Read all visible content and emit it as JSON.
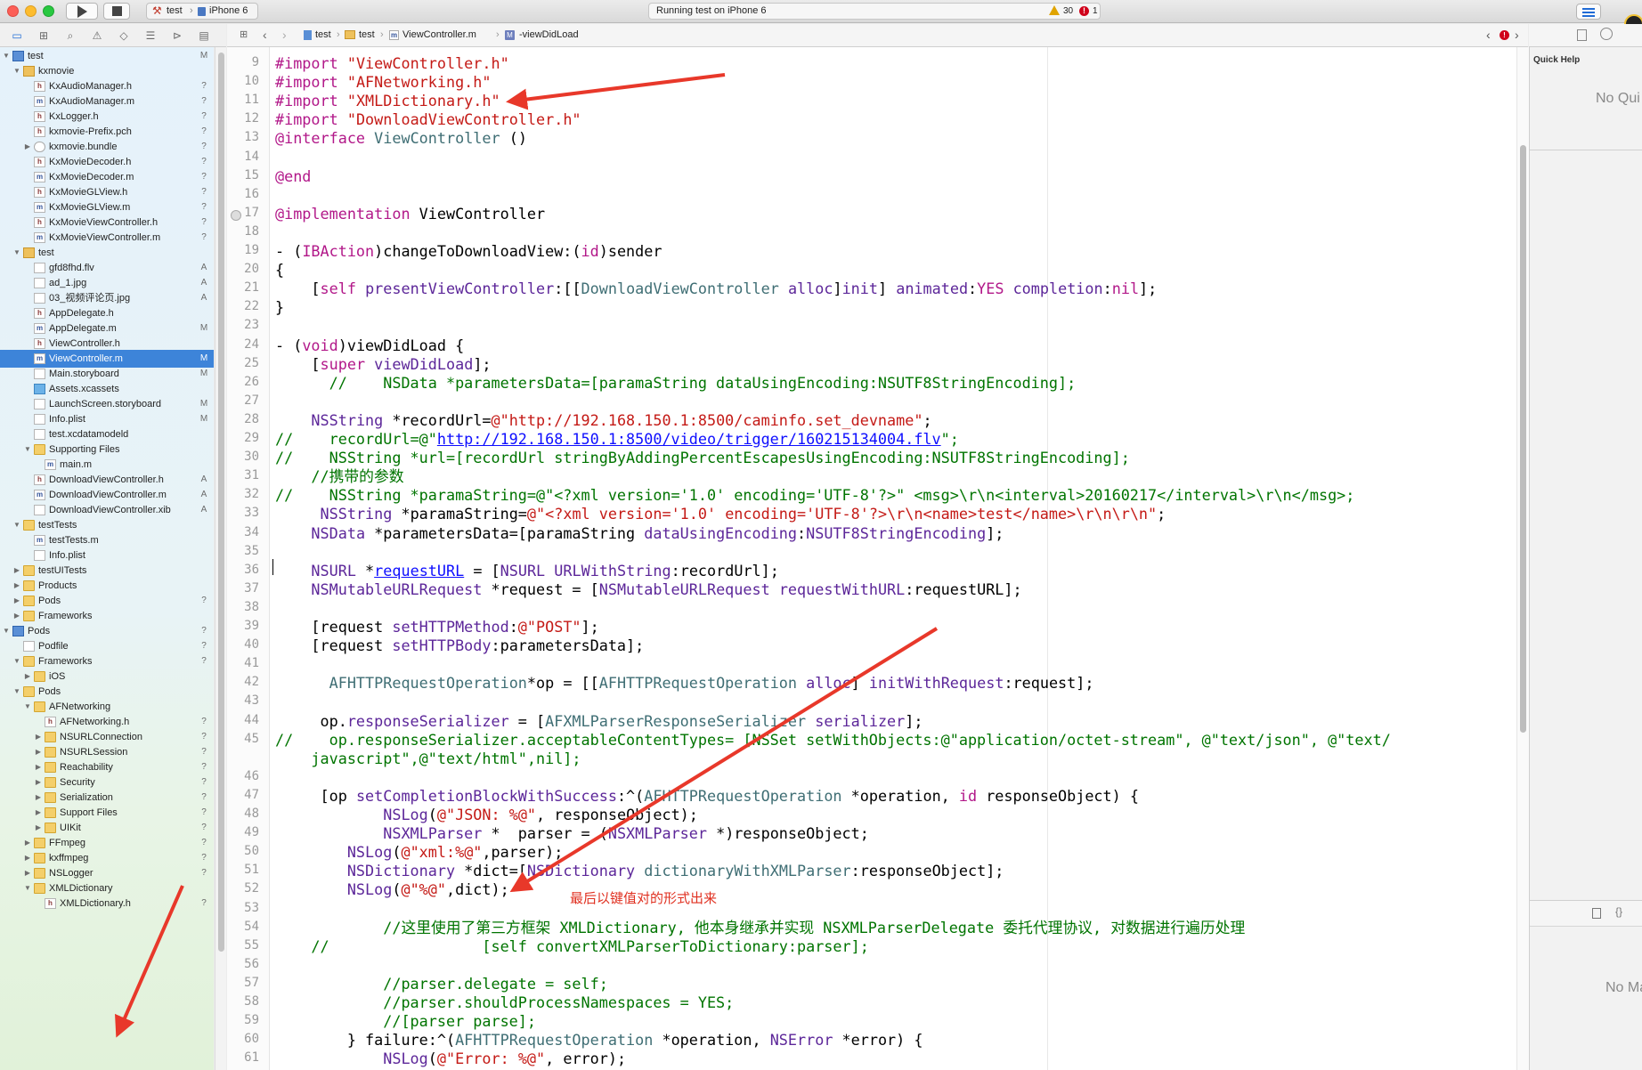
{
  "toolbar": {
    "scheme": "test",
    "device": "iPhone 6",
    "status": "Running test on iPhone 6",
    "warnings": "30",
    "errors": "1"
  },
  "jumpbar": {
    "crumbs": [
      "test",
      "test",
      "ViewController.m",
      "-viewDidLoad"
    ]
  },
  "navigator": {
    "rows": [
      {
        "d": 0,
        "disc": "open",
        "icon": "proj",
        "name": "test",
        "st": "M"
      },
      {
        "d": 1,
        "disc": "open",
        "icon": "group",
        "name": "kxmovie",
        "st": ""
      },
      {
        "d": 2,
        "disc": "",
        "icon": "h",
        "name": "KxAudioManager.h",
        "st": "?"
      },
      {
        "d": 2,
        "disc": "",
        "icon": "m",
        "name": "KxAudioManager.m",
        "st": "?"
      },
      {
        "d": 2,
        "disc": "",
        "icon": "h",
        "name": "KxLogger.h",
        "st": "?"
      },
      {
        "d": 2,
        "disc": "",
        "icon": "h",
        "name": "kxmovie-Prefix.pch",
        "st": "?"
      },
      {
        "d": 2,
        "disc": "closed",
        "icon": "bundle",
        "name": "kxmovie.bundle",
        "st": "?"
      },
      {
        "d": 2,
        "disc": "",
        "icon": "h",
        "name": "KxMovieDecoder.h",
        "st": "?"
      },
      {
        "d": 2,
        "disc": "",
        "icon": "m",
        "name": "KxMovieDecoder.m",
        "st": "?"
      },
      {
        "d": 2,
        "disc": "",
        "icon": "h",
        "name": "KxMovieGLView.h",
        "st": "?"
      },
      {
        "d": 2,
        "disc": "",
        "icon": "m",
        "name": "KxMovieGLView.m",
        "st": "?"
      },
      {
        "d": 2,
        "disc": "",
        "icon": "h",
        "name": "KxMovieViewController.h",
        "st": "?"
      },
      {
        "d": 2,
        "disc": "",
        "icon": "m",
        "name": "KxMovieViewController.m",
        "st": "?"
      },
      {
        "d": 1,
        "disc": "open",
        "icon": "group",
        "name": "test",
        "st": ""
      },
      {
        "d": 2,
        "disc": "",
        "icon": "other",
        "name": "gfd8fhd.flv",
        "st": "A"
      },
      {
        "d": 2,
        "disc": "",
        "icon": "other",
        "name": "ad_1.jpg",
        "st": "A"
      },
      {
        "d": 2,
        "disc": "",
        "icon": "other",
        "name": "03_视频评论页.jpg",
        "st": "A"
      },
      {
        "d": 2,
        "disc": "",
        "icon": "h",
        "name": "AppDelegate.h",
        "st": ""
      },
      {
        "d": 2,
        "disc": "",
        "icon": "m",
        "name": "AppDelegate.m",
        "st": "M"
      },
      {
        "d": 2,
        "disc": "",
        "icon": "h",
        "name": "ViewController.h",
        "st": ""
      },
      {
        "d": 2,
        "disc": "",
        "icon": "m",
        "name": "ViewController.m",
        "st": "M",
        "sel": true
      },
      {
        "d": 2,
        "disc": "",
        "icon": "other",
        "name": "Main.storyboard",
        "st": "M"
      },
      {
        "d": 2,
        "disc": "",
        "icon": "assets",
        "name": "Assets.xcassets",
        "st": ""
      },
      {
        "d": 2,
        "disc": "",
        "icon": "other",
        "name": "LaunchScreen.storyboard",
        "st": "M"
      },
      {
        "d": 2,
        "disc": "",
        "icon": "other",
        "name": "Info.plist",
        "st": "M"
      },
      {
        "d": 2,
        "disc": "",
        "icon": "other",
        "name": "test.xcdatamodeld",
        "st": ""
      },
      {
        "d": 2,
        "disc": "open",
        "icon": "folder",
        "name": "Supporting Files",
        "st": ""
      },
      {
        "d": 3,
        "disc": "",
        "icon": "m",
        "name": "main.m",
        "st": ""
      },
      {
        "d": 2,
        "disc": "",
        "icon": "h",
        "name": "DownloadViewController.h",
        "st": "A"
      },
      {
        "d": 2,
        "disc": "",
        "icon": "m",
        "name": "DownloadViewController.m",
        "st": "A"
      },
      {
        "d": 2,
        "disc": "",
        "icon": "other",
        "name": "DownloadViewController.xib",
        "st": "A"
      },
      {
        "d": 1,
        "disc": "open",
        "icon": "folder",
        "name": "testTests",
        "st": ""
      },
      {
        "d": 2,
        "disc": "",
        "icon": "m",
        "name": "testTests.m",
        "st": ""
      },
      {
        "d": 2,
        "disc": "",
        "icon": "other",
        "name": "Info.plist",
        "st": ""
      },
      {
        "d": 1,
        "disc": "closed",
        "icon": "folder",
        "name": "testUITests",
        "st": ""
      },
      {
        "d": 1,
        "disc": "closed",
        "icon": "folder",
        "name": "Products",
        "st": ""
      },
      {
        "d": 1,
        "disc": "closed",
        "icon": "folder",
        "name": "Pods",
        "st": "?"
      },
      {
        "d": 1,
        "disc": "closed",
        "icon": "folder",
        "name": "Frameworks",
        "st": ""
      },
      {
        "d": 0,
        "disc": "open",
        "icon": "proj",
        "name": "Pods",
        "st": "?"
      },
      {
        "d": 1,
        "disc": "",
        "icon": "other",
        "name": "Podfile",
        "st": "?"
      },
      {
        "d": 1,
        "disc": "open",
        "icon": "folder",
        "name": "Frameworks",
        "st": "?"
      },
      {
        "d": 2,
        "disc": "closed",
        "icon": "folder",
        "name": "iOS",
        "st": ""
      },
      {
        "d": 1,
        "disc": "open",
        "icon": "folder",
        "name": "Pods",
        "st": ""
      },
      {
        "d": 2,
        "disc": "open",
        "icon": "folder",
        "name": "AFNetworking",
        "st": ""
      },
      {
        "d": 3,
        "disc": "",
        "icon": "h",
        "name": "AFNetworking.h",
        "st": "?"
      },
      {
        "d": 3,
        "disc": "closed",
        "icon": "folder",
        "name": "NSURLConnection",
        "st": "?"
      },
      {
        "d": 3,
        "disc": "closed",
        "icon": "folder",
        "name": "NSURLSession",
        "st": "?"
      },
      {
        "d": 3,
        "disc": "closed",
        "icon": "folder",
        "name": "Reachability",
        "st": "?"
      },
      {
        "d": 3,
        "disc": "closed",
        "icon": "folder",
        "name": "Security",
        "st": "?"
      },
      {
        "d": 3,
        "disc": "closed",
        "icon": "folder",
        "name": "Serialization",
        "st": "?"
      },
      {
        "d": 3,
        "disc": "closed",
        "icon": "folder",
        "name": "Support Files",
        "st": "?"
      },
      {
        "d": 3,
        "disc": "closed",
        "icon": "folder",
        "name": "UIKit",
        "st": "?"
      },
      {
        "d": 2,
        "disc": "closed",
        "icon": "folder",
        "name": "FFmpeg",
        "st": "?"
      },
      {
        "d": 2,
        "disc": "closed",
        "icon": "folder",
        "name": "kxffmpeg",
        "st": "?"
      },
      {
        "d": 2,
        "disc": "closed",
        "icon": "folder",
        "name": "NSLogger",
        "st": "?"
      },
      {
        "d": 2,
        "disc": "open",
        "icon": "folder",
        "name": "XMLDictionary",
        "st": ""
      },
      {
        "d": 3,
        "disc": "",
        "icon": "h",
        "name": "XMLDictionary.h",
        "st": "?"
      }
    ]
  },
  "editor": {
    "lines": [
      {
        "n": "9",
        "html": "<span class=\"k\">#import</span> <span class=\"s\">\"ViewController.h\"</span>"
      },
      {
        "n": "10",
        "html": "<span class=\"k\">#import</span> <span class=\"s\">\"AFNetworking.h\"</span>"
      },
      {
        "n": "11",
        "html": "<span class=\"k\">#import</span> <span class=\"s\">\"XMLDictionary.h\"</span>"
      },
      {
        "n": "12",
        "html": "<span class=\"k\">#import</span> <span class=\"s\">\"DownloadViewController.h\"</span>"
      },
      {
        "n": "13",
        "html": "<span class=\"k\">@interface</span> <span class=\"cls\">ViewController</span> ()"
      },
      {
        "n": "14",
        "html": ""
      },
      {
        "n": "15",
        "html": "<span class=\"k\">@end</span>"
      },
      {
        "n": "16",
        "html": ""
      },
      {
        "n": "17",
        "html": "<span class=\"k\">@implementation</span> ViewController"
      },
      {
        "n": "18",
        "html": ""
      },
      {
        "n": "19",
        "html": "- (<span class=\"k\">IBAction</span>)changeToDownloadView:(<span class=\"k\">id</span>)sender"
      },
      {
        "n": "20",
        "html": "{"
      },
      {
        "n": "21",
        "html": "    [<span class=\"k\">self</span> <span class=\"t\">presentViewController</span>:[[<span class=\"cls\">DownloadViewController</span> <span class=\"t\">alloc</span>]<span class=\"t\">init</span>] <span class=\"t\">animated</span>:<span class=\"k\">YES</span> <span class=\"t\">completion</span>:<span class=\"k\">nil</span>];"
      },
      {
        "n": "22",
        "html": "}"
      },
      {
        "n": "23",
        "html": ""
      },
      {
        "n": "24",
        "html": "- (<span class=\"k\">void</span>)viewDidLoad {"
      },
      {
        "n": "25",
        "html": "    [<span class=\"k\">super</span> <span class=\"t\">viewDidLoad</span>];"
      },
      {
        "n": "26",
        "html": "<span class=\"c\">      //    NSData *parametersData=[paramaString dataUsingEncoding:NSUTF8StringEncoding];</span>"
      },
      {
        "n": "27",
        "html": ""
      },
      {
        "n": "28",
        "html": "    <span class=\"t\">NSString</span> *recordUrl=<span class=\"s\">@\"http://192.168.150.1:8500/caminfo.set_devname\"</span>;"
      },
      {
        "n": "29",
        "html": "<span class=\"c\">//    recordUrl=@\"</span><span class=\"u\">http://192.168.150.1:8500/video/trigger/160215134004.flv</span><span class=\"c\">\";</span>"
      },
      {
        "n": "30",
        "html": "<span class=\"c\">//    NSString *url=[recordUrl stringByAddingPercentEscapesUsingEncoding:NSUTF8StringEncoding];</span>"
      },
      {
        "n": "31",
        "html": "<span class=\"c\">    //携带的参数</span>"
      },
      {
        "n": "32",
        "html": "<span class=\"c\">//    NSString *paramaString=@\"&lt;?xml version='1.0' encoding='UTF-8'?&gt;\" &lt;msg&gt;\\r\\n&lt;interval&gt;20160217&lt;/interval&gt;\\r\\n&lt;/msg&gt;;</span>"
      },
      {
        "n": "33",
        "html": "     <span class=\"t\">NSString</span> *paramaString=<span class=\"s\">@\"&lt;?xml version='1.0' encoding='UTF-8'?&gt;\\r\\n&lt;name&gt;test&lt;/name&gt;\\r\\n\\r\\n\"</span>;"
      },
      {
        "n": "34",
        "html": "    <span class=\"t\">NSData</span> *parametersData=[paramaString <span class=\"t\">dataUsingEncoding</span>:<span class=\"t\">NSUTF8StringEncoding</span>];"
      },
      {
        "n": "35",
        "html": ""
      },
      {
        "n": "36",
        "html": "    <span class=\"t\">NSURL</span> *<span class=\"u\">requestURL</span> = [<span class=\"t\">NSURL</span> <span class=\"t\">URLWithString</span>:recordUrl];"
      },
      {
        "n": "37",
        "html": "    <span class=\"t\">NSMutableURLRequest</span> *request = [<span class=\"t\">NSMutableURLRequest</span> <span class=\"t\">requestWithURL</span>:requestURL];"
      },
      {
        "n": "38",
        "html": ""
      },
      {
        "n": "39",
        "html": "    [request <span class=\"t\">setHTTPMethod</span>:<span class=\"s\">@\"POST\"</span>];"
      },
      {
        "n": "40",
        "html": "    [request <span class=\"t\">setHTTPBody</span>:parametersData];"
      },
      {
        "n": "41",
        "html": ""
      },
      {
        "n": "42",
        "html": "      <span class=\"cls\">AFHTTPRequestOperation</span>*op = [[<span class=\"cls\">AFHTTPRequestOperation</span> <span class=\"t\">alloc</span>] <span class=\"t\">initWithRequest</span>:request];"
      },
      {
        "n": "43",
        "html": ""
      },
      {
        "n": "44",
        "html": "     op.<span class=\"t\">responseSerializer</span> = [<span class=\"cls\">AFXMLParserResponseSerializer</span> <span class=\"t\">serializer</span>];"
      },
      {
        "n": "45",
        "html": "<span class=\"c\">//    op.responseSerializer.acceptableContentTypes= [NSSet setWithObjects:@\"application/octet-stream\", @\"text/json\", @\"text/</span>"
      },
      {
        "n": "",
        "html": "<span class=\"c\">    javascript\",@\"text/html\",nil];</span>"
      },
      {
        "n": "46",
        "html": ""
      },
      {
        "n": "47",
        "html": "     [op <span class=\"t\">setCompletionBlockWithSuccess</span>:^(<span class=\"cls\">AFHTTPRequestOperation</span> *operation, <span class=\"k\">id</span> responseObject) {"
      },
      {
        "n": "48",
        "html": "            <span class=\"t\">NSLog</span>(<span class=\"s\">@\"JSON: %@\"</span>, responseObject);"
      },
      {
        "n": "49",
        "html": "            <span class=\"t\">NSXMLParser</span> *  parser = (<span class=\"t\">NSXMLParser</span> *)responseObject;"
      },
      {
        "n": "50",
        "html": "        <span class=\"t\">NSLog</span>(<span class=\"s\">@\"xml:%@\"</span>,parser);"
      },
      {
        "n": "51",
        "html": "        <span class=\"t\">NSDictionary</span> *dict=[<span class=\"t\">NSDictionary</span> <span class=\"cls\">dictionaryWithXMLParser</span>:responseObject];"
      },
      {
        "n": "52",
        "html": "        <span class=\"t\">NSLog</span>(<span class=\"s\">@\"%@\"</span>,dict);"
      },
      {
        "n": "53",
        "html": ""
      },
      {
        "n": "54",
        "html": "<span class=\"c\">            //这里使用了第三方框架 XMLDictionary, 他本身继承并实现 NSXMLParserDelegate 委托代理协议, 对数据进行遍历处理</span>"
      },
      {
        "n": "55",
        "html": "<span class=\"c\">    //                 [self convertXMLParserToDictionary:parser];</span>"
      },
      {
        "n": "56",
        "html": ""
      },
      {
        "n": "57",
        "html": "<span class=\"c\">            //parser.delegate = self;</span>"
      },
      {
        "n": "58",
        "html": "<span class=\"c\">            //parser.shouldProcessNamespaces = YES;</span>"
      },
      {
        "n": "59",
        "html": "<span class=\"c\">            //[parser parse];</span>"
      },
      {
        "n": "60",
        "html": "        } failure:^(<span class=\"cls\">AFHTTPRequestOperation</span> *operation, <span class=\"t\">NSError</span> *error) {"
      },
      {
        "n": "61",
        "html": "            <span class=\"t\">NSLog</span>(<span class=\"s\">@\"Error: %@\"</span>, error);"
      }
    ],
    "annotation": "最后以键值对的形式出来"
  },
  "utilities": {
    "quick_help_title": "Quick Help",
    "quick_help_empty": "No Qui",
    "library_empty": "No Ma"
  },
  "colors": {
    "selection": "#3d84d9",
    "annotation_arrow": "#e8382a"
  },
  "icons": [
    "play-icon",
    "stop-icon",
    "folder-icon",
    "warning-icon",
    "error-icon",
    "chevron-left-icon",
    "chevron-right-icon",
    "grid-icon"
  ]
}
